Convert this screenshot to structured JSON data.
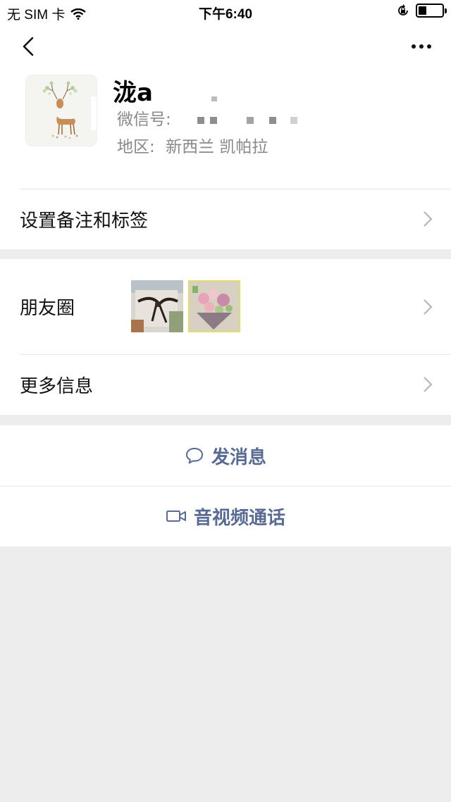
{
  "status_bar": {
    "carrier": "无 SIM 卡",
    "time": "下午6:40",
    "battery_level": 0.35
  },
  "profile": {
    "nickname": "泷a",
    "wechat_id_label": "微信号:",
    "region_label": "地区:",
    "region_value": "新西兰 凯帕拉"
  },
  "rows": {
    "remark": "设置备注和标签",
    "moments": "朋友圈",
    "more_info": "更多信息"
  },
  "actions": {
    "message": "发消息",
    "video_call": "音视频通话"
  },
  "colors": {
    "link": "#576b95",
    "background": "#ededed"
  }
}
